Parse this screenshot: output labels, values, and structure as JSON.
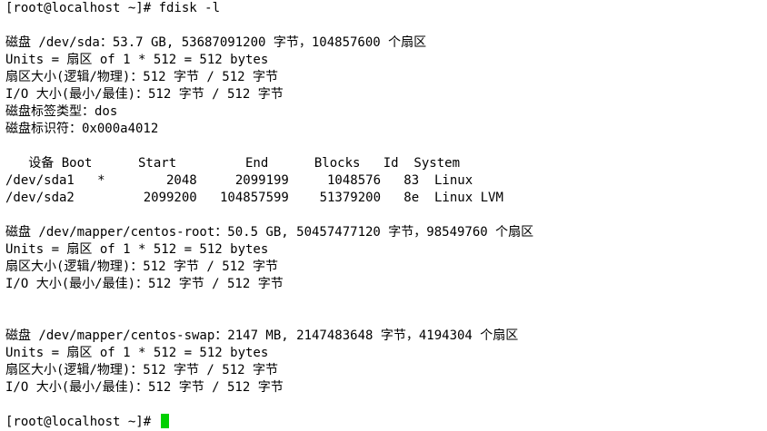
{
  "terminal": {
    "cursor_color": "#00d000",
    "lines": [
      "[root@localhost ~]# fdisk -l",
      "",
      "磁盘 /dev/sda：53.7 GB, 53687091200 字节，104857600 个扇区",
      "Units = 扇区 of 1 * 512 = 512 bytes",
      "扇区大小(逻辑/物理)：512 字节 / 512 字节",
      "I/O 大小(最小/最佳)：512 字节 / 512 字节",
      "磁盘标签类型：dos",
      "磁盘标识符：0x000a4012",
      "",
      "   设备 Boot      Start         End      Blocks   Id  System",
      "/dev/sda1   *        2048     2099199     1048576   83  Linux",
      "/dev/sda2         2099200   104857599    51379200   8e  Linux LVM",
      "",
      "磁盘 /dev/mapper/centos-root：50.5 GB, 50457477120 字节，98549760 个扇区",
      "Units = 扇区 of 1 * 512 = 512 bytes",
      "扇区大小(逻辑/物理)：512 字节 / 512 字节",
      "I/O 大小(最小/最佳)：512 字节 / 512 字节",
      "",
      "",
      "磁盘 /dev/mapper/centos-swap：2147 MB, 2147483648 字节，4194304 个扇区",
      "Units = 扇区 of 1 * 512 = 512 bytes",
      "扇区大小(逻辑/物理)：512 字节 / 512 字节",
      "I/O 大小(最小/最佳)：512 字节 / 512 字节",
      "",
      "[root@localhost ~]# "
    ]
  }
}
